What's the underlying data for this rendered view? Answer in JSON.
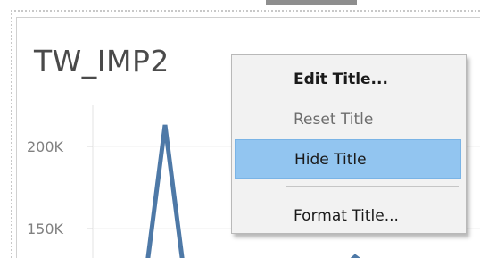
{
  "chart": {
    "title": "TW_IMP2",
    "y_ticks": [
      "200K",
      "150K"
    ],
    "line_color": "#4e79a7"
  },
  "context_menu": {
    "items": [
      {
        "label": "Edit Title...",
        "style": "bold",
        "enabled": true
      },
      {
        "label": "Reset Title",
        "style": "normal",
        "enabled": false
      },
      {
        "label": "Hide Title",
        "style": "normal",
        "enabled": true,
        "highlighted": true
      },
      {
        "label": "Format Title...",
        "style": "normal",
        "enabled": true
      }
    ],
    "highlight_color": "#92c5f0"
  }
}
